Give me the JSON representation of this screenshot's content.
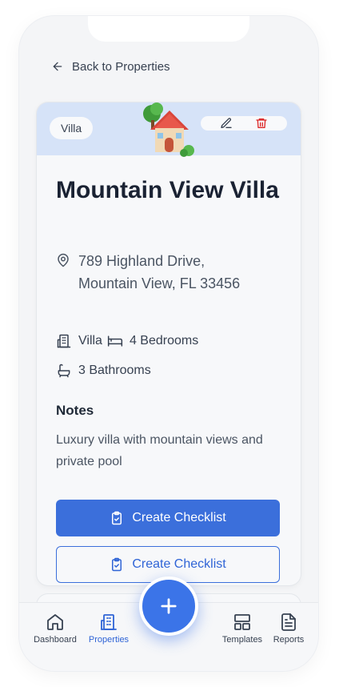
{
  "header": {
    "back_label": "Back to Properties"
  },
  "property": {
    "type_badge": "Villa",
    "name": "Mountain View Villa",
    "address": "789 Highland Drive, Mountain View, FL 33456",
    "type": "Villa",
    "bedrooms": "4 Bedrooms",
    "bathrooms": "3 Bathrooms",
    "notes_title": "Notes",
    "notes": "Luxury villa with mountain views and private pool"
  },
  "actions": {
    "primary_label": "Create Checklist",
    "secondary_label": "Create Checklist"
  },
  "nav": {
    "items": [
      {
        "label": "Dashboard",
        "icon": "home-icon"
      },
      {
        "label": "Properties",
        "icon": "building-icon",
        "active": true
      },
      {
        "label": "Templates",
        "icon": "layout-icon"
      },
      {
        "label": "Reports",
        "icon": "file-text-icon"
      }
    ],
    "fab_icon": "plus-icon"
  },
  "colors": {
    "accent": "#3b6fdb",
    "header_band": "#d6e3f8",
    "delete": "#dc2626",
    "background": "#f4f5f7"
  }
}
